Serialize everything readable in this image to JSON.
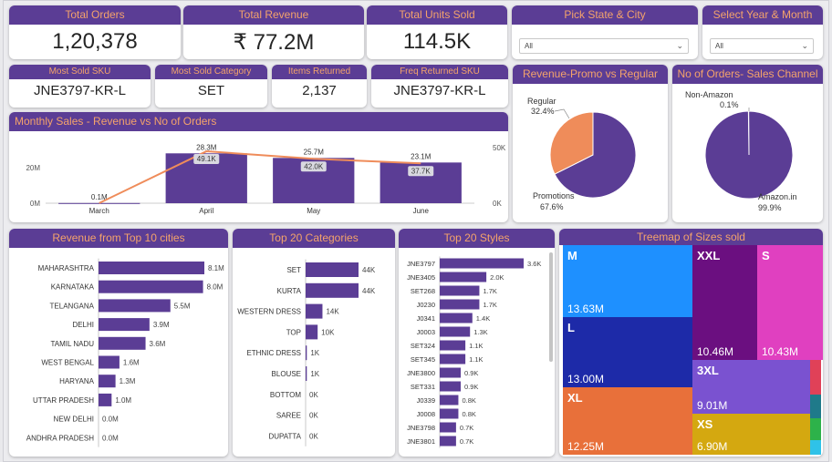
{
  "kpis": {
    "total_orders": {
      "title": "Total Orders",
      "value": "1,20,378"
    },
    "total_revenue": {
      "title": "Total Revenue",
      "value": "₹ 77.2M"
    },
    "total_units": {
      "title": "Total Units Sold",
      "value": "114.5K"
    },
    "most_sold_sku": {
      "title": "Most Sold SKU",
      "value": "JNE3797-KR-L"
    },
    "most_sold_category": {
      "title": "Most Sold Category",
      "value": "SET"
    },
    "items_returned": {
      "title": "Items Returned",
      "value": "2,137"
    },
    "freq_returned_sku": {
      "title": "Freq Returned SKU",
      "value": "JNE3797-KR-L"
    }
  },
  "filters": {
    "state_city": {
      "title": "Pick State & City",
      "value": "All"
    },
    "year_month": {
      "title": "Select Year & Month",
      "value": "All"
    }
  },
  "colors": {
    "header_bg": "#5b3d95",
    "header_text": "#f4a36b",
    "bar": "#5b3d95",
    "line": "#ef8c5a"
  },
  "monthly": {
    "title": "Monthly Sales - Revenue vs No of Orders",
    "chart_data": {
      "type": "bar",
      "categories": [
        "March",
        "April",
        "May",
        "June"
      ],
      "series": [
        {
          "values": [
            0.1,
            28.3,
            25.7,
            23.1
          ],
          "labels": [
            "0.1M",
            "28.3M",
            "25.7M",
            "23.1M"
          ]
        },
        {
          "values": [
            0.1,
            49.1,
            42.0,
            37.7
          ],
          "labels": [
            "",
            "49.1K",
            "42.0K",
            "37.7K"
          ]
        }
      ],
      "left_ticks": [
        "20M",
        "0M"
      ],
      "right_ticks": [
        "50K",
        "0K"
      ]
    }
  },
  "promo": {
    "title": "Revenue-Promo vs Regular",
    "chart_data": {
      "type": "pie",
      "slices": [
        {
          "name": "Promotions",
          "pct": "67.6%",
          "value": 67.6,
          "color": "#5b3d95"
        },
        {
          "name": "Regular",
          "pct": "32.4%",
          "value": 32.4,
          "color": "#ef8c5a"
        }
      ]
    }
  },
  "channel": {
    "title": "No of Orders- Sales Channel",
    "chart_data": {
      "type": "pie",
      "slices": [
        {
          "name": "Amazon.in",
          "pct": "99.9%",
          "value": 99.9,
          "color": "#5b3d95"
        },
        {
          "name": "Non-Amazon",
          "pct": "0.1%",
          "value": 0.1,
          "color": "#ef8c5a"
        }
      ]
    }
  },
  "cities": {
    "title": "Revenue from Top 10 cities",
    "chart_data": {
      "type": "bar",
      "categories": [
        "MAHARASHTRA",
        "KARNATAKA",
        "TELANGANA",
        "DELHI",
        "TAMIL NADU",
        "WEST BENGAL",
        "HARYANA",
        "UTTAR PRADESH",
        "NEW DELHI",
        "ANDHRA PRADESH"
      ],
      "values": [
        8.1,
        8.0,
        5.5,
        3.9,
        3.6,
        1.6,
        1.3,
        1.0,
        0.0,
        0.0
      ],
      "labels": [
        "8.1M",
        "8.0M",
        "5.5M",
        "3.9M",
        "3.6M",
        "1.6M",
        "1.3M",
        "1.0M",
        "0.0M",
        "0.0M"
      ],
      "xmax": 8.1
    }
  },
  "categories": {
    "title": "Top 20 Categories",
    "chart_data": {
      "type": "bar",
      "categories": [
        "SET",
        "KURTA",
        "WESTERN DRESS",
        "TOP",
        "ETHNIC DRESS",
        "BLOUSE",
        "BOTTOM",
        "SAREE",
        "DUPATTA"
      ],
      "values": [
        44,
        44,
        14,
        10,
        1,
        1,
        0,
        0,
        0
      ],
      "labels": [
        "44K",
        "44K",
        "14K",
        "10K",
        "1K",
        "1K",
        "0K",
        "0K",
        "0K"
      ],
      "xmax": 44
    }
  },
  "styles": {
    "title": "Top 20 Styles",
    "chart_data": {
      "type": "bar",
      "categories": [
        "JNE3797",
        "JNE3405",
        "SET268",
        "J0230",
        "J0341",
        "J0003",
        "SET324",
        "SET345",
        "JNE3800",
        "SET331",
        "J0339",
        "J0008",
        "JNE3798",
        "JNE3801"
      ],
      "values": [
        3.6,
        2.0,
        1.7,
        1.7,
        1.4,
        1.3,
        1.1,
        1.1,
        0.9,
        0.9,
        0.8,
        0.8,
        0.7,
        0.7
      ],
      "labels": [
        "3.6K",
        "2.0K",
        "1.7K",
        "1.7K",
        "1.4K",
        "1.3K",
        "1.1K",
        "1.1K",
        "0.9K",
        "0.9K",
        "0.8K",
        "0.8K",
        "0.7K",
        "0.7K"
      ],
      "xmax": 3.6
    }
  },
  "treemap": {
    "title": "Treemap of Sizes sold",
    "chart_data": {
      "type": "treemap",
      "items": [
        {
          "name": "M",
          "value": "13.63M",
          "color": "#1e90ff"
        },
        {
          "name": "L",
          "value": "13.00M",
          "color": "#1d2aa8"
        },
        {
          "name": "XL",
          "value": "12.25M",
          "color": "#e8703a"
        },
        {
          "name": "XXL",
          "value": "10.46M",
          "color": "#6b0f80"
        },
        {
          "name": "S",
          "value": "10.43M",
          "color": "#e040c0"
        },
        {
          "name": "3XL",
          "value": "9.01M",
          "color": "#7a52d0"
        },
        {
          "name": "XS",
          "value": "6.90M",
          "color": "#d4a810"
        }
      ],
      "small_colors": [
        "#e04158",
        "#1f7a8a",
        "#2db24a",
        "#2fc2e8"
      ]
    }
  }
}
